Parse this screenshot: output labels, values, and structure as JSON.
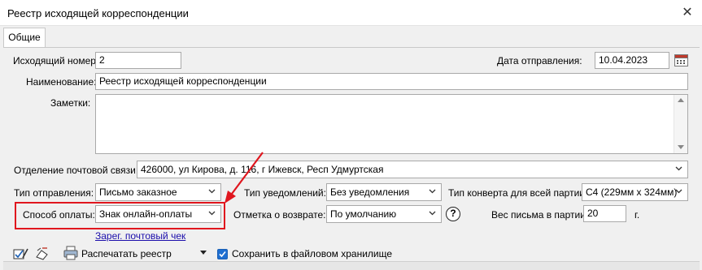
{
  "window": {
    "title": "Реестр исходящей корреспонденции",
    "close_icon": "close-icon"
  },
  "tabs": [
    {
      "label": "Общие"
    }
  ],
  "fields": {
    "outgoing_number": {
      "label": "Исходящий номер:",
      "value": "2"
    },
    "send_date": {
      "label": "Дата отправления:",
      "value": "10.04.2023"
    },
    "name": {
      "label": "Наименование:",
      "value": "Реестр исходящей корреспонденции"
    },
    "notes": {
      "label": "Заметки:",
      "value": ""
    },
    "post_office": {
      "label": "Отделение почтовой связи:",
      "value": "426000, ул Кирова, д. 116, г Ижевск, Респ Удмуртская"
    },
    "send_type": {
      "label": "Тип отправления:",
      "value": "Письмо заказное"
    },
    "notification_type": {
      "label": "Тип уведомлений:",
      "value": "Без уведомления"
    },
    "envelope_type": {
      "label": "Тип конверта для всей партии:",
      "value": "С4 (229мм x 324мм)"
    },
    "payment_method": {
      "label": "Способ оплаты:",
      "value": "Знак онлайн-оплаты"
    },
    "return_mark": {
      "label": "Отметка о возврате:",
      "value": "По умолчанию"
    },
    "batch_weight": {
      "label": "Вес письма в партии:",
      "value": "20",
      "unit": "г."
    }
  },
  "links": {
    "register_check": "Зарег. почтовый чек"
  },
  "toolbar": {
    "print_label": "Распечатать реестр",
    "save_checkbox_label": "Сохранить в файловом хранилище",
    "save_checked": true
  },
  "colors": {
    "highlight": "#e0161e",
    "link": "#1a0dab",
    "checkbox": "#1f6fd1"
  }
}
